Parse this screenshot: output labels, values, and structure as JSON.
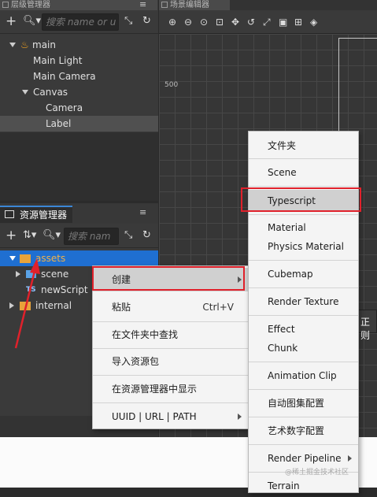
{
  "hierarchy": {
    "title": "层级管理器",
    "search_placeholder": "搜索 name or u",
    "nodes": [
      {
        "label": "main"
      },
      {
        "label": "Main Light"
      },
      {
        "label": "Main Camera"
      },
      {
        "label": "Canvas"
      },
      {
        "label": "Camera"
      },
      {
        "label": "Label"
      }
    ]
  },
  "scene": {
    "title": "场景编辑器",
    "ruler_label": "500",
    "edge_label": "正则"
  },
  "assets": {
    "title": "资源管理器",
    "search_placeholder": "搜索 nam",
    "nodes": [
      {
        "label": "assets"
      },
      {
        "label": "scene"
      },
      {
        "label": "newScript",
        "badge": "TS"
      },
      {
        "label": "internal"
      }
    ]
  },
  "context_menu": {
    "items": [
      {
        "label": "创建"
      },
      {
        "label": "粘贴",
        "shortcut": "Ctrl+V"
      },
      {
        "label": "在文件夹中查找"
      },
      {
        "label": "导入资源包"
      },
      {
        "label": "在资源管理器中显示"
      },
      {
        "label": "UUID | URL | PATH"
      }
    ]
  },
  "create_submenu": {
    "items": [
      {
        "label": "文件夹"
      },
      {
        "label": "Scene"
      },
      {
        "label": "Typescript"
      },
      {
        "label": "Material"
      },
      {
        "label": "Physics Material"
      },
      {
        "label": "Cubemap"
      },
      {
        "label": "Render Texture"
      },
      {
        "label": "Effect"
      },
      {
        "label": "Chunk"
      },
      {
        "label": "Animation Clip"
      },
      {
        "label": "自动图集配置"
      },
      {
        "label": "艺术数字配置"
      },
      {
        "label": "Render Pipeline"
      },
      {
        "label": "Terrain"
      }
    ]
  },
  "watermark": "@稀土掘金技术社区",
  "colors": {
    "highlight_red": "#e0212b",
    "selection_blue": "#1f6fd1",
    "folder_yellow": "#e8a33a"
  }
}
